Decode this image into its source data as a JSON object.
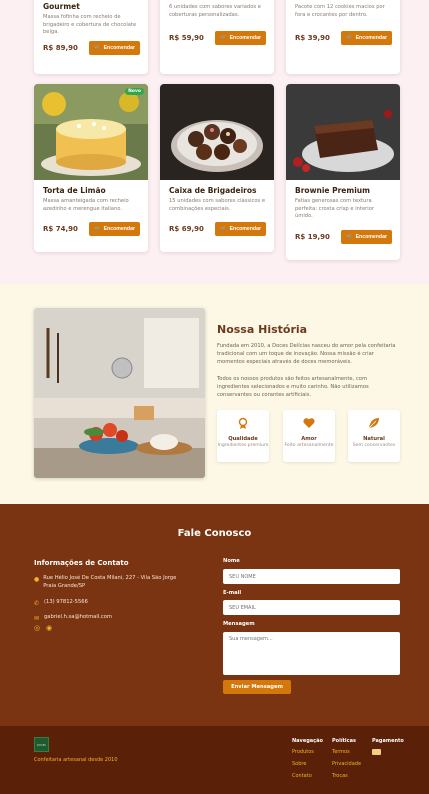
{
  "products_row1": [
    {
      "title": "Gourmet",
      "desc": "Massa fofinha com recheio de brigadeiro e cobertura de chocolate belga.",
      "price": "R$ 89,90",
      "button": "Encomendar"
    },
    {
      "title": "",
      "desc": "6 unidades com sabores variados e coberturas personalizadas.",
      "price": "R$ 59,90",
      "button": "Encomendar"
    },
    {
      "title": "",
      "desc": "Pacote com 12 cookies macios por fora e crocantes por dentro.",
      "price": "R$ 39,90",
      "button": "Encomendar"
    }
  ],
  "products_row2": [
    {
      "title": "Torta de Limão",
      "desc": "Massa amanteigada com recheio azedinho e merengue italiano.",
      "price": "R$ 74,90",
      "button": "Encomendar",
      "badge": "Novo"
    },
    {
      "title": "Caixa de Brigadeiros",
      "desc": "15 unidades com sabores clássicos e combinações especiais.",
      "price": "R$ 69,90",
      "button": "Encomendar"
    },
    {
      "title": "Brownie Premium",
      "desc": "Fatias generosas com textura perfeita: crosta crisp e interior úmido.",
      "price": "R$ 19,90",
      "button": "Encomendar"
    }
  ],
  "story": {
    "title": "Nossa História",
    "p1": "Fundada em 2010, a Doces Delícias nasceu do amor pela confeitaria tradicional com um toque de inovação. Nossa missão é criar momentos especiais através de doces memoráveis.",
    "p2": "Todos os nossos produtos são feitos artesanalmente, com ingredientes selecionados e muito carinho. Não utilizamos conservantes ou corantes artificiais.",
    "features": [
      {
        "icon": "award-icon",
        "title": "Qualidade",
        "sub": "Ingredientes premium"
      },
      {
        "icon": "heart-icon",
        "title": "Amor",
        "sub": "Feito artesanalmente"
      },
      {
        "icon": "leaf-icon",
        "title": "Natural",
        "sub": "Sem conservantes"
      }
    ]
  },
  "contact": {
    "title": "Fale Conosco",
    "info_title": "Informações de Contato",
    "address": "Rue Hélio José De Costa Milani, 227 - Vila São Jorge Praia Grande/SP",
    "phone": "(13) 97812-5566",
    "email": "gabriel.h.sa@hotmail.com",
    "form": {
      "name_label": "Nome",
      "name_placeholder": "SEU NOME",
      "email_label": "E-mail",
      "email_placeholder": "SEU EMAIL",
      "msg_label": "Mensagem",
      "msg_placeholder": "Sua mensagem...",
      "submit": "Enviar Mensagem"
    }
  },
  "footer": {
    "logo_text": "DOCES",
    "tagline": "Confeitaria artesanal desde 2010",
    "nav_title": "Navegação",
    "nav": [
      "Produtos",
      "Sobre",
      "Contato"
    ],
    "policy_title": "Políticas",
    "policies": [
      "Termos",
      "Privacidade",
      "Trocas"
    ],
    "pay_title": "Pagamento"
  },
  "colors": {
    "accent": "#d4780c",
    "brown": "#7a3411",
    "footer": "#5a2108",
    "gold": "#f0b429"
  }
}
